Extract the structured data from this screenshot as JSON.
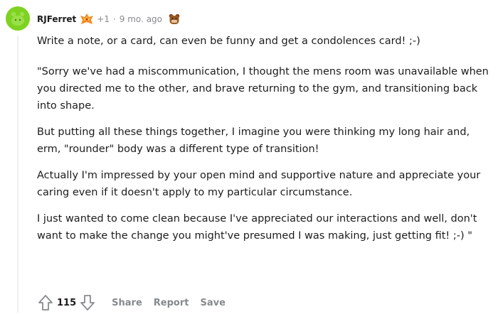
{
  "comment": {
    "username": "RJFerret",
    "karma": "+1",
    "separator": "·",
    "age": "9 mo. ago",
    "flair_icon": "firebird-flair-icon",
    "award_icon": "bear-award-icon",
    "avatar_icon": "snoo-avatar-icon",
    "paragraphs": [
      "Write a note, or a card, can even be funny and get a condolences card! ;-)",
      "\"Sorry we've had a miscommunication, I thought the mens room was unavailable when you directed me to the other, and brave returning to the gym, and transitioning back into shape.",
      "But putting all these things together, I imagine you were thinking my long hair and, erm, \"rounder\" body was a different type of transition!",
      "Actually I'm impressed by your open mind and supportive nature and appreciate your caring even if it doesn't apply to my particular circumstance.",
      "I just wanted to come clean because I've appreciated our interactions and well, don't want to make the change you might've presumed I was making, just getting fit! ;-) \""
    ],
    "score": "115",
    "actions": {
      "share": "Share",
      "report": "Report",
      "save": "Save"
    }
  },
  "colors": {
    "avatar_bg": "#7ed321",
    "text": "#1c1c1c",
    "muted": "#878a8c",
    "thread_line": "#edeff1"
  }
}
